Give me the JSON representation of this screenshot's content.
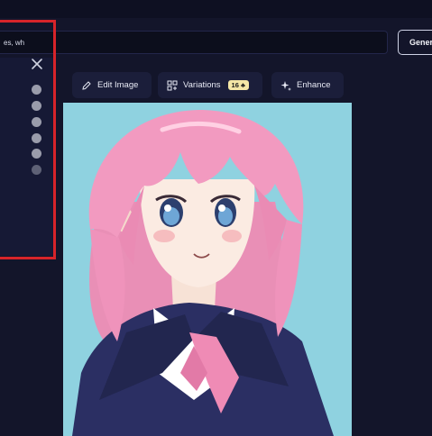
{
  "prompt": {
    "value": "es, wh"
  },
  "header": {
    "generate_label": "Gener"
  },
  "side_panel": {
    "dot_count": 6
  },
  "toolbar": {
    "edit_image": "Edit Image",
    "variations": "Variations",
    "variations_badge": "16",
    "enhance": "Enhance"
  },
  "colors": {
    "background": "#13152a",
    "highlight_border": "#d7242a",
    "image_background": "#8fd2e0",
    "badge": "#f4e6a6"
  }
}
